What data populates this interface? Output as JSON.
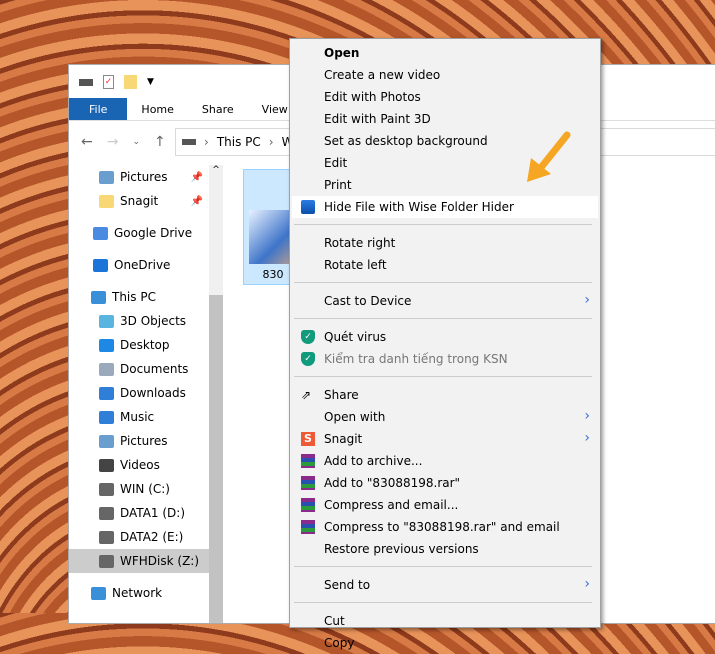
{
  "explorer": {
    "ribbon_tabs": [
      "File",
      "Home",
      "Share",
      "View"
    ],
    "address": [
      "This PC",
      "WI"
    ],
    "nav_pane": [
      {
        "label": "Pictures",
        "icon": "pictures-icon",
        "pinned": true
      },
      {
        "label": "Snagit",
        "icon": "folder-icon",
        "pinned": true
      },
      {
        "label": "Google Drive",
        "icon": "google-drive-icon"
      },
      {
        "label": "OneDrive",
        "icon": "onedrive-icon"
      },
      {
        "label": "This PC",
        "icon": "computer-icon"
      },
      {
        "label": "3D Objects",
        "icon": "3d-objects-icon"
      },
      {
        "label": "Desktop",
        "icon": "desktop-icon"
      },
      {
        "label": "Documents",
        "icon": "documents-icon"
      },
      {
        "label": "Downloads",
        "icon": "downloads-icon"
      },
      {
        "label": "Music",
        "icon": "music-icon"
      },
      {
        "label": "Pictures",
        "icon": "pictures-icon"
      },
      {
        "label": "Videos",
        "icon": "videos-icon"
      },
      {
        "label": "WIN (C:)",
        "icon": "drive-icon"
      },
      {
        "label": "DATA1 (D:)",
        "icon": "drive-icon"
      },
      {
        "label": "DATA2 (E:)",
        "icon": "drive-icon"
      },
      {
        "label": "WFHDisk (Z:)",
        "icon": "drive-icon",
        "selected": true
      },
      {
        "label": "Network",
        "icon": "network-icon"
      }
    ],
    "file_label": "830"
  },
  "context_menu": [
    {
      "label": "Open",
      "bold": true
    },
    {
      "label": "Create a new video"
    },
    {
      "label": "Edit with Photos"
    },
    {
      "label": "Edit with Paint 3D"
    },
    {
      "label": "Set as desktop background"
    },
    {
      "label": "Edit"
    },
    {
      "label": "Print"
    },
    {
      "label": "Hide File with Wise Folder Hider",
      "icon": "wise-folder-hider-icon",
      "highlighted": true
    },
    {
      "sep": true
    },
    {
      "label": "Rotate right"
    },
    {
      "label": "Rotate left"
    },
    {
      "sep": true
    },
    {
      "label": "Cast to Device",
      "submenu": true
    },
    {
      "sep": true
    },
    {
      "label": "Quét virus",
      "icon": "kaspersky-shield-icon"
    },
    {
      "label": "Kiểm tra danh tiếng trong KSN",
      "icon": "kaspersky-shield-icon",
      "disabled": true
    },
    {
      "sep": true
    },
    {
      "label": "Share",
      "icon": "share-icon"
    },
    {
      "label": "Open with",
      "submenu": true
    },
    {
      "label": "Snagit",
      "icon": "snagit-icon",
      "submenu": true
    },
    {
      "label": "Add to archive...",
      "icon": "winrar-icon"
    },
    {
      "label": "Add to \"83088198.rar\"",
      "icon": "winrar-icon"
    },
    {
      "label": "Compress and email...",
      "icon": "winrar-icon"
    },
    {
      "label": "Compress to \"83088198.rar\" and email",
      "icon": "winrar-icon"
    },
    {
      "label": "Restore previous versions"
    },
    {
      "sep": true
    },
    {
      "label": "Send to",
      "submenu": true
    },
    {
      "sep": true
    },
    {
      "label": "Cut"
    },
    {
      "label": "Copy"
    }
  ],
  "colors": {
    "accent": "#1a64b4",
    "arrow": "#f5a623",
    "selection": "#cce8ff"
  }
}
